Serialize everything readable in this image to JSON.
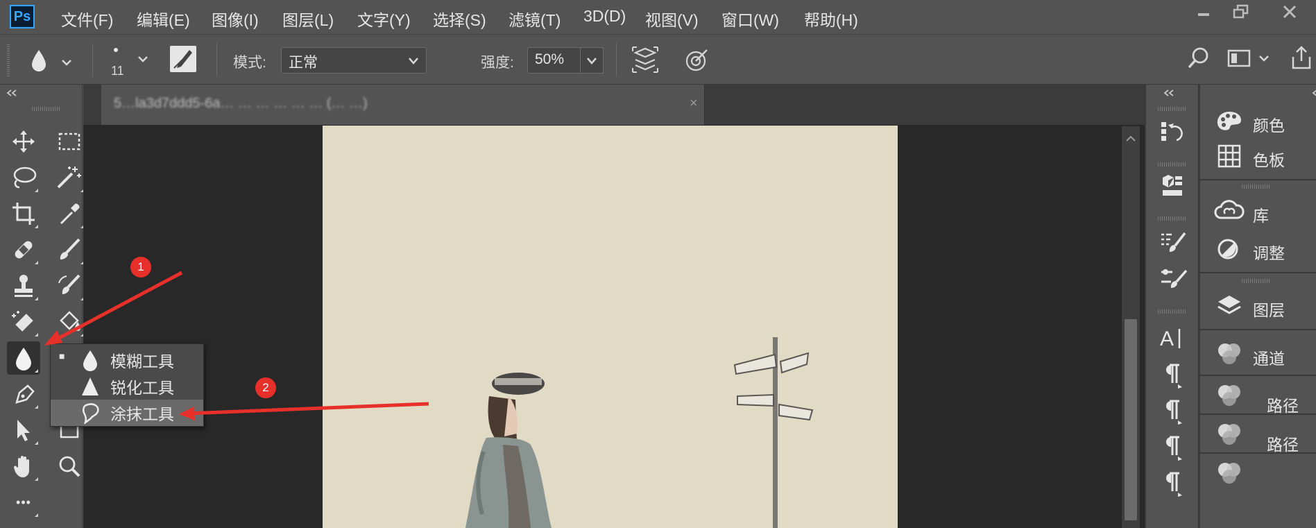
{
  "app": {
    "logo": "Ps",
    "menu": [
      "文件(F)",
      "编辑(E)",
      "图像(I)",
      "图层(L)",
      "文字(Y)",
      "选择(S)",
      "滤镜(T)",
      "3D(D)",
      "视图(V)",
      "窗口(W)",
      "帮助(H)"
    ],
    "window_controls": [
      "minimize-icon",
      "restore-icon",
      "close-icon"
    ]
  },
  "options_bar": {
    "brush_size": "11",
    "mode_label": "模式:",
    "mode_value": "正常",
    "strength_label": "强度:",
    "strength_value": "50%"
  },
  "document": {
    "tab_title": "5…la3d7ddd5-6a… … … … … … (… …)",
    "tab_close": "×"
  },
  "toolbar": {
    "tools": [
      "move",
      "marquee",
      "lasso",
      "magic-wand",
      "crop",
      "eyedropper",
      "healing-brush",
      "brush",
      "clone-stamp",
      "history-brush",
      "eraser",
      "paint-bucket",
      "blur",
      "pen",
      "path-selection",
      "rectangle",
      "hand",
      "zoom"
    ],
    "more": "•••"
  },
  "flyout": {
    "items": [
      {
        "label": "模糊工具",
        "icon": "blur-drop-icon",
        "selected_marker": "■"
      },
      {
        "label": "锐化工具",
        "icon": "sharpen-triangle-icon"
      },
      {
        "label": "涂抹工具",
        "icon": "smudge-finger-icon"
      }
    ],
    "highlighted_index": 2
  },
  "annotations": {
    "badge1": "1",
    "badge2": "2",
    "arrow_color": "#e8302b"
  },
  "panels": [
    {
      "label": "颜色",
      "icon": "color-palette-icon"
    },
    {
      "label": "色板",
      "icon": "swatches-grid-icon"
    },
    {
      "label": "库",
      "icon": "cc-libraries-icon"
    },
    {
      "label": "调整",
      "icon": "adjustments-icon"
    },
    {
      "label": "图层",
      "icon": "layers-icon"
    },
    {
      "label": "通道",
      "icon": "channels-icon"
    },
    {
      "label": "路径",
      "icon": "channels-icon"
    },
    {
      "label": "路径",
      "icon": "channels-icon"
    }
  ],
  "colors": {
    "ui_bg": "#535353",
    "canvas": "#e1dbc6",
    "ps_blue": "#31a8ff"
  }
}
